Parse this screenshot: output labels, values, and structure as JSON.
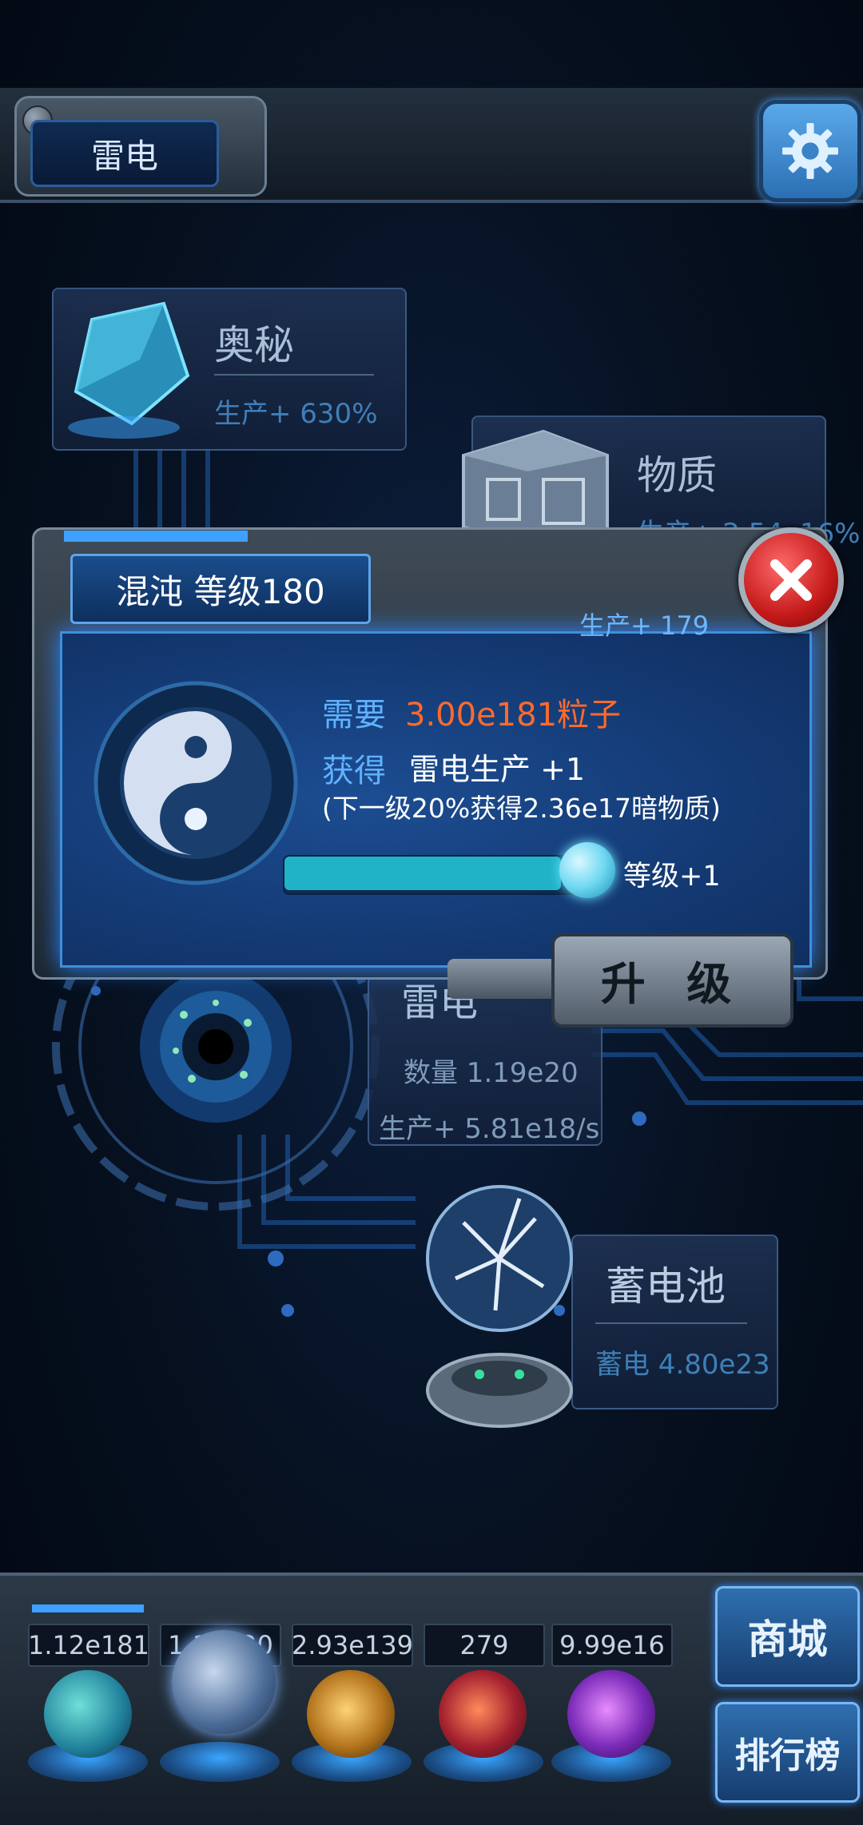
{
  "header": {
    "title": "雷电"
  },
  "cards": {
    "mystery": {
      "name": "奥秘",
      "stat": "生产+ 630%"
    },
    "matter": {
      "name": "物质",
      "stat": "生产+ 2.54e16%"
    },
    "thunder": {
      "name": "雷电",
      "count": "数量 1.19e20",
      "production": "生产+ 5.81e18/s"
    },
    "battery": {
      "name": "蓄电池",
      "stat": "蓄电 4.80e23"
    }
  },
  "popup": {
    "title": "混沌 等级180",
    "production": "生产+ 179",
    "require_label": "需要",
    "require_value": "3.00e181粒子",
    "gain_label": "获得",
    "gain_value": "雷电生产 +1",
    "next_level_note": "(下一级20%获得2.36e17暗物质)",
    "level_step": "等级+1",
    "progress": 0.92,
    "upgrade_label": "升 级"
  },
  "bottom_bar": {
    "slots": [
      "1.12e181",
      "1.19e20",
      "2.93e139",
      "279",
      "9.99e16"
    ],
    "shop_label": "商城",
    "ranking_label": "排行榜"
  },
  "colors": {
    "accent": "#3d8fe0",
    "require_value": "#ff6a2b",
    "label_blue": "#5fb2ff",
    "progress": "#20b3c8",
    "close": "#c41919"
  }
}
